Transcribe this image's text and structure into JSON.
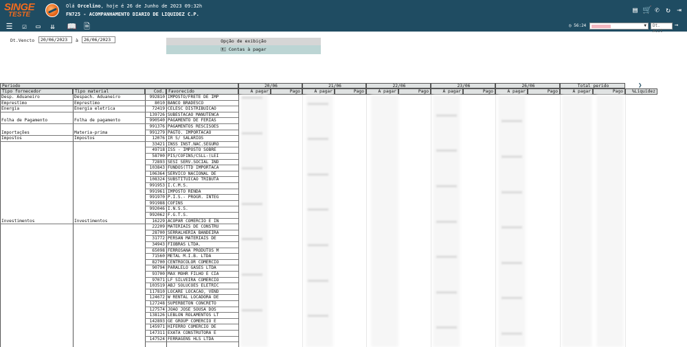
{
  "header": {
    "logo_main": "SINGE",
    "logo_sub": "TESTE",
    "hello_prefix": "Olá ",
    "user_name": "Orcelino",
    "hello_suffix": ", hoje é 26 de Junho de 2023 09:32h",
    "screen_title": "FN725 - ACOMPANHAMENTO DIARIO DE LIQUIDEZ C.P.",
    "icons": [
      "document-icon",
      "cart-icon",
      "phone-icon",
      "refresh-icon",
      "logout-door-icon"
    ]
  },
  "toolbar": {
    "icons": [
      "list-icon",
      "checklist-icon",
      "window-icon",
      "collapse-icon",
      "book-icon",
      "pdf-icon"
    ],
    "timer": "56:24",
    "refresh_button": "Dt. Atit"
  },
  "filters": {
    "dt_label": "Dt.Vencto",
    "date_from": "20/06/2023",
    "sep": "à",
    "date_to": "26/06/2023",
    "display_option_title": "Opção de exibição",
    "display_option_value": "Contas à pagar"
  },
  "grid": {
    "top_header": "Periodo",
    "date_columns": [
      "20/06",
      "21/06",
      "22/06",
      "23/06",
      "26/06"
    ],
    "total_column": "Total perido",
    "sub_a_pagar": "À pagar",
    "sub_pago": "Pago",
    "col_tipo_fornecedor": "Tipo fornecedor",
    "col_tipo_material": "Tipo material",
    "col_cod": "Cod.",
    "col_favorecido": "Favorecido",
    "col_liquidez": "%Liquidez",
    "rows": [
      {
        "tf": "Desp. Aduaneiro",
        "tm": "Despach. Aduaneiro",
        "cod": "992810",
        "fav": "IMPOSTO/FRETE DE IMP"
      },
      {
        "tf": "Emprestimo",
        "tm": "Emprestimo",
        "cod": "8010",
        "fav": "BANCO BRADESCO"
      },
      {
        "tf": "Energia",
        "tm": "Energia eletrica",
        "cod": "72419",
        "fav": "CELESC DISTRIBUICAO"
      },
      {
        "tf": "",
        "tm": "",
        "cod": "139726",
        "fav": "SUBESTACAO MANUTENCA"
      },
      {
        "tf": "Folha de Pagamento",
        "tm": "Folha de pagamento",
        "cod": "990540",
        "fav": "PAGAMENTO DE FERIAS"
      },
      {
        "tf": "",
        "tm": "",
        "cod": "991376",
        "fav": "PAGAMENTOS RESCISOES"
      },
      {
        "tf": "Importações",
        "tm": "Materia-prima",
        "cod": "991279",
        "fav": "PAGTO. IMPORTACAO"
      },
      {
        "tf": "Impostos",
        "tm": "Impostos",
        "cod": "12076",
        "fav": "IR S/ SALARIOS"
      },
      {
        "tf": "",
        "tm": "",
        "cod": "33421",
        "fav": "INSS INST.NAC.SEGURO"
      },
      {
        "tf": "",
        "tm": "",
        "cod": "49718",
        "fav": "ISS - IMPOSTO SOBRE"
      },
      {
        "tf": "",
        "tm": "",
        "cod": "58700",
        "fav": "PIS/COFINS/CSLL-(LEI"
      },
      {
        "tf": "",
        "tm": "",
        "cod": "72893",
        "fav": "SESI SERV.SOCIAL IND"
      },
      {
        "tf": "",
        "tm": "",
        "cod": "103843",
        "fav": "FUNDOS(TTD IMPORTACA"
      },
      {
        "tf": "",
        "tm": "",
        "cod": "106364",
        "fav": "SERVICO NACIONAL DE"
      },
      {
        "tf": "",
        "tm": "",
        "cod": "108324",
        "fav": "SUBSTITUICAO TRIBUTA"
      },
      {
        "tf": "",
        "tm": "",
        "cod": "991953",
        "fav": "I.C.M.S."
      },
      {
        "tf": "",
        "tm": "",
        "cod": "991961",
        "fav": "IMPOSTO RENDA"
      },
      {
        "tf": "",
        "tm": "",
        "cod": "991970",
        "fav": "P.I.S.- PROGR. INTEG"
      },
      {
        "tf": "",
        "tm": "",
        "cod": "991988",
        "fav": "COFINS"
      },
      {
        "tf": "",
        "tm": "",
        "cod": "992046",
        "fav": "I.N.S.S."
      },
      {
        "tf": "",
        "tm": "",
        "cod": "992062",
        "fav": "F.G.T.S."
      },
      {
        "tf": "Investimentos",
        "tm": "Investimentos",
        "cod": "16229",
        "fav": "ACOPAR COMERCIO E IN"
      },
      {
        "tf": "",
        "tm": "",
        "cod": "22209",
        "fav": "MATERIAIS DE CONSTRU"
      },
      {
        "tf": "",
        "tm": "",
        "cod": "28700",
        "fav": "SERRALHERIA BANDEIRA"
      },
      {
        "tf": "",
        "tm": "",
        "cod": "31772",
        "fav": "PERSAN MATERIAIS DE"
      },
      {
        "tf": "",
        "tm": "",
        "cod": "34943",
        "fav": "FIOBRAS LTDA."
      },
      {
        "tf": "",
        "tm": "",
        "cod": "65098",
        "fav": "FERROSANA PRODUTOS M"
      },
      {
        "tf": "",
        "tm": "",
        "cod": "71560",
        "fav": "METAL M.I.B. LTDA"
      },
      {
        "tf": "",
        "tm": "",
        "cod": "82700",
        "fav": "CENTROCOLOR COMERCIO"
      },
      {
        "tf": "",
        "tm": "",
        "cod": "90794",
        "fav": "PARALELO GASES LTDA"
      },
      {
        "tf": "",
        "tm": "",
        "cod": "93700",
        "fav": "MAX MOHR FILHO E CIA"
      },
      {
        "tf": "",
        "tm": "",
        "cod": "97071",
        "fav": "LF SILVEIRA COMERCIO"
      },
      {
        "tf": "",
        "tm": "",
        "cod": "103519",
        "fav": "ABJ SOLUCOES ELETRIC"
      },
      {
        "tf": "",
        "tm": "",
        "cod": "117810",
        "fav": "LOCARE LOCACAO, VEND"
      },
      {
        "tf": "",
        "tm": "",
        "cod": "124672",
        "fav": "W RENTAL LOCADORA DE"
      },
      {
        "tf": "",
        "tm": "",
        "cod": "127248",
        "fav": "SUPERBETON CONCRETO"
      },
      {
        "tf": "",
        "tm": "",
        "cod": "127574",
        "fav": "JOAO JOSE SOUSA DOS"
      },
      {
        "tf": "",
        "tm": "",
        "cod": "138126",
        "fav": "LEBLON ROLAMENTOS LT"
      },
      {
        "tf": "",
        "tm": "",
        "cod": "142893",
        "fav": "GE GROUP COMERCIO E"
      },
      {
        "tf": "",
        "tm": "",
        "cod": "145971",
        "fav": "HIFERRO COMERCIO DE"
      },
      {
        "tf": "",
        "tm": "",
        "cod": "147311",
        "fav": "EXATA CONSTRUTORA E"
      },
      {
        "tf": "",
        "tm": "",
        "cod": "147524",
        "fav": "FERRAGENS HLS LTDA"
      }
    ]
  },
  "colors": {
    "header_bg": "#1f4c62",
    "brand_orange": "#f26b1d",
    "option_bg": "#bcd5d4"
  }
}
